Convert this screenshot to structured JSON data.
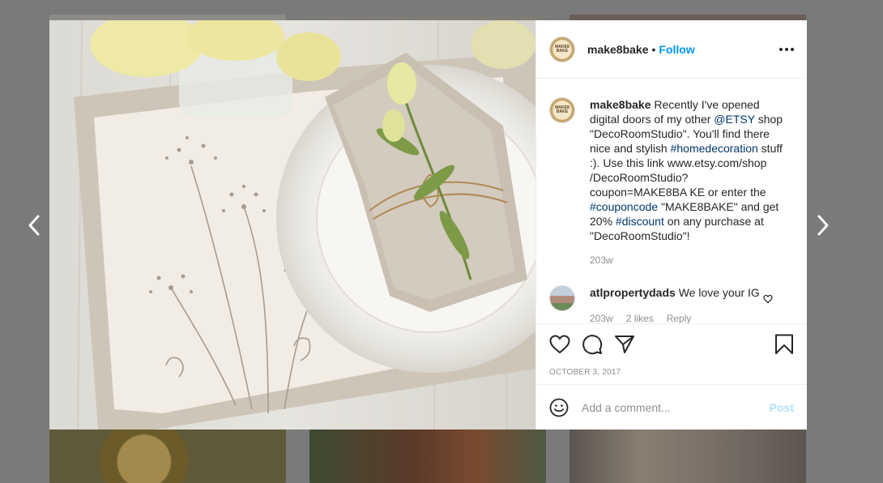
{
  "post": {
    "username": "make8bake",
    "follow_label": "Follow",
    "separator": "•",
    "avatar_text": "MAKE8 BAKE",
    "photo_description_icon": "post-photo"
  },
  "caption": {
    "username": "make8bake",
    "parts": {
      "p1": " Recently I've opened digital doors of my other ",
      "tag1": "@ETSY",
      "p2": " shop \"DecoRoomStudio\". You'll find there nice and stylish ",
      "tag2": "#homedecoration",
      "p3": " stuff :). Use this link www.etsy.com/shop /DecoRoomStudio?coupon=MAKE8BA KE or enter the ",
      "tag3": "#couponcode",
      "p4": " \"MAKE8BAKE\" and get 20% ",
      "tag4": "#discount",
      "p5": " on any purchase at \"DecoRoomStudio\"!"
    },
    "time_ago": "203w"
  },
  "comments": [
    {
      "username": "atlpropertydads",
      "text": " We love your IG",
      "time_ago": "203w",
      "likes": "2 likes",
      "reply_label": "Reply"
    }
  ],
  "actions": {
    "icons": [
      "heart-icon",
      "comment-icon",
      "share-icon",
      "bookmark-icon"
    ],
    "date": "OCTOBER 3, 2017"
  },
  "add_comment": {
    "placeholder": "Add a comment...",
    "post_label": "Post"
  },
  "colors": {
    "follow": "#0095f6",
    "tag": "#00376b",
    "muted": "#8e8e8e",
    "post_disabled": "#b2dffc"
  }
}
